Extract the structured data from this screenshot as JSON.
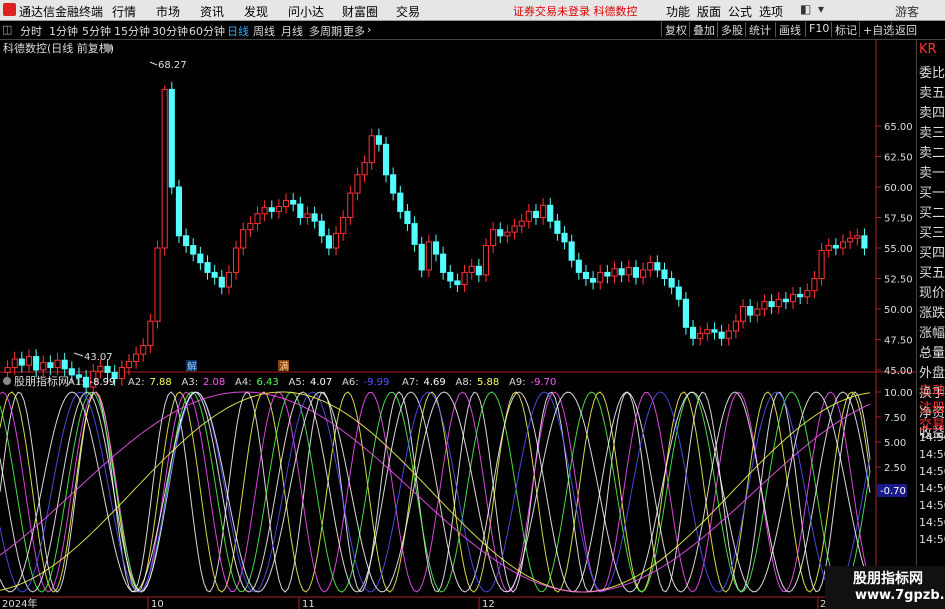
{
  "titlebar": {
    "app_name": "通达信金融终端",
    "menus": [
      "行情",
      "市场",
      "资讯",
      "发现",
      "问小达",
      "财富圈",
      "交易"
    ],
    "notice": "证券交易未登录  科德数控",
    "right_menus": [
      "功能",
      "版面",
      "公式",
      "选项"
    ],
    "guest": "游客"
  },
  "period_bar": {
    "periods": [
      "分时",
      "1分钟",
      "5分钟",
      "15分钟",
      "30分钟",
      "60分钟",
      "日线",
      "周线",
      "月线",
      "多周期",
      "更多"
    ],
    "active": "日线",
    "tools": [
      "复权",
      "叠加",
      "多股",
      "统计",
      "画线",
      "F10",
      "标记",
      "+自选",
      "返回"
    ]
  },
  "main_chart": {
    "title": "科德数控(日线 前复权)",
    "high_label": "68.27",
    "low_label": "43.07",
    "price_ticks": [
      "65.00",
      "62.50",
      "60.00",
      "57.50",
      "55.00",
      "52.50",
      "50.00",
      "47.50",
      "45.00"
    ],
    "markers": [
      "解",
      "满"
    ]
  },
  "indicator": {
    "name": "股朋指标网",
    "values": [
      {
        "label": "A1:",
        "value": "-8.99",
        "color": "#ffffff"
      },
      {
        "label": "A2:",
        "value": "7.88",
        "color": "#ffff55"
      },
      {
        "label": "A3:",
        "value": "2.08",
        "color": "#ff55ff"
      },
      {
        "label": "A4:",
        "value": "6.43",
        "color": "#55ff55"
      },
      {
        "label": "A5:",
        "value": "4.07",
        "color": "#ffffff"
      },
      {
        "label": "A6:",
        "value": "-9.99",
        "color": "#5555ff"
      },
      {
        "label": "A7:",
        "value": "4.69",
        "color": "#ffffff"
      },
      {
        "label": "A8:",
        "value": "5.88",
        "color": "#ffff55"
      },
      {
        "label": "A9:",
        "value": "-9.70",
        "color": "#ff55ff"
      }
    ],
    "ticks": [
      "10.00",
      "7.50",
      "5.00",
      "2.50",
      "0.00"
    ],
    "current_value": "-0.70"
  },
  "date_axis": [
    "2024年",
    "10",
    "11",
    "12",
    "2"
  ],
  "right_panel": {
    "items": [
      "KR",
      "委比",
      "卖五",
      "卖四",
      "卖三",
      "卖二",
      "卖一",
      "买一",
      "买二",
      "买三",
      "买四",
      "买五",
      "现价",
      "涨跌",
      "涨幅",
      "总量",
      "外盘",
      "换手",
      "净资",
      "收益",
      "自动",
      "注册",
      "交易",
      "14:50",
      "14:50",
      "14:50",
      "14:50",
      "14:50",
      "14:50",
      "14:50"
    ]
  },
  "watermark": {
    "line1": "股朋指标网",
    "line2": "www.7gpzb.com"
  },
  "colors": {
    "up": "#ff3333",
    "down": "#54ffff",
    "axis": "#aa2222",
    "background": "#000000"
  }
}
